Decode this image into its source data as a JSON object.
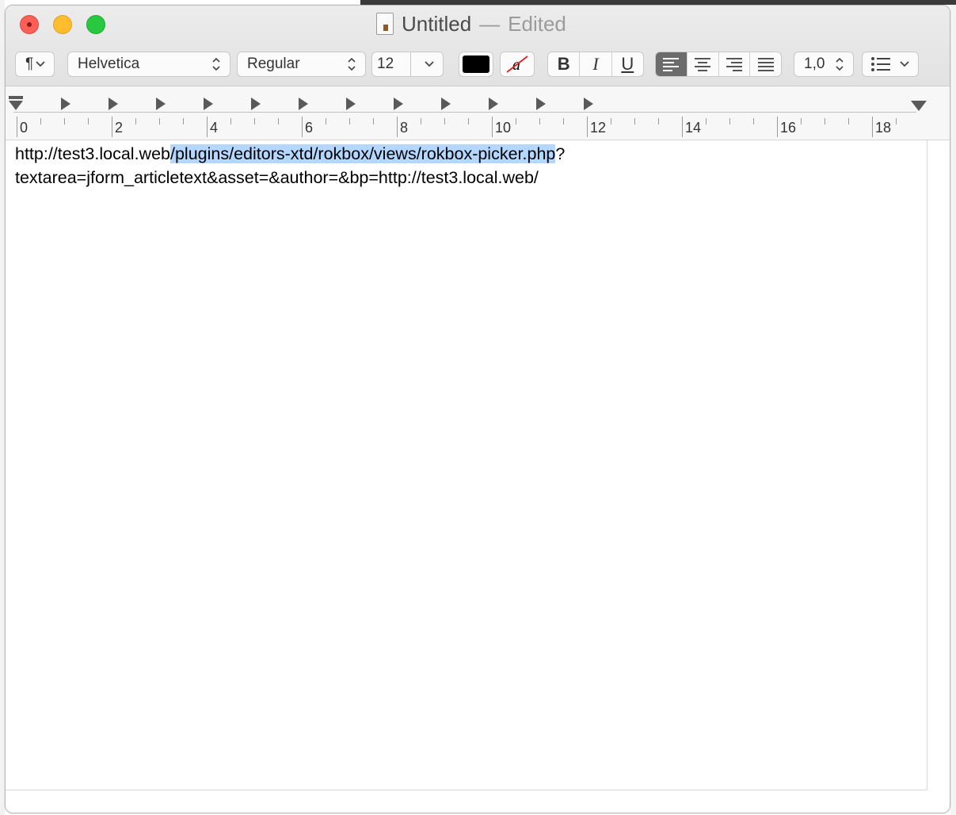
{
  "window": {
    "title": "Untitled",
    "title_separator": "—",
    "status": "Edited"
  },
  "toolbar": {
    "paragraph_style_glyph": "¶",
    "font_family": "Helvetica",
    "typeface": "Regular",
    "font_size": "12",
    "text_color": "#000000",
    "highlight_glyph": "a",
    "bold_label": "B",
    "italic_label": "I",
    "underline_label": "U",
    "alignment_selected": "left",
    "line_spacing": "1,0",
    "list_icon": "list-bullets-icon"
  },
  "ruler": {
    "labels": [
      "0",
      "2",
      "4",
      "6",
      "8",
      "10",
      "12",
      "14",
      "16",
      "18"
    ]
  },
  "document": {
    "line1_before": "http://test3.local.web",
    "line1_selected": "/plugins/editors-xtd/rokbox/views/rokbox-picker.php",
    "line1_after": "?",
    "line2": "textarea=jform_articletext&asset=&author=&bp=http://test3.local.web/",
    "selection_color": "#b3d7ff"
  }
}
